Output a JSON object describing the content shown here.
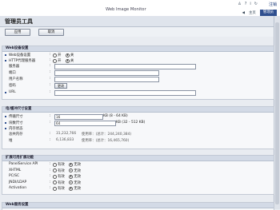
{
  "header": {
    "app_title": "Web Image Monitor",
    "logout": "注销",
    "user_strip": {
      "home": "主页",
      "admin": "管理员"
    }
  },
  "page_title": "管理员工具",
  "buttons": {
    "apply": "应用",
    "cancel": "取消"
  },
  "web_settings": {
    "heading": "Web设备设置",
    "rows": [
      {
        "label": "Web设备设置",
        "options": [
          "开",
          "关"
        ],
        "selected": 1
      },
      {
        "label": "HTTP代理服务器",
        "options": [
          "开",
          "关"
        ],
        "selected": 1
      },
      {
        "label": "服务器"
      },
      {
        "label": "端口"
      },
      {
        "label": "用户名称"
      },
      {
        "label": "密码",
        "button": "更改"
      },
      {
        "label": "URL"
      }
    ]
  },
  "buffer": {
    "heading": "电/缓冲尺寸设置",
    "rows": [
      {
        "label": "传输尺寸",
        "value": "16",
        "unit": "KB (8 - 64 KB)"
      },
      {
        "label": "块数尺寸",
        "value": "64",
        "unit": "KB (32 - 512 KB)"
      },
      {
        "label": "内存状态"
      },
      {
        "label": "总共内存",
        "value": "31,232,766",
        "extra": "使用率：(总计：244,240,384)"
      },
      {
        "label": "堆",
        "value": "6,136,833",
        "extra": "使用率：(总计：16,465,760)"
      }
    ]
  },
  "extensions": {
    "heading": "扩展可用扩展功能",
    "rows": [
      {
        "label": "PanelService API",
        "options": [
          "有效",
          "无效"
        ],
        "selected": 1
      },
      {
        "label": "XHTML",
        "options": [
          "有效",
          "无效"
        ],
        "selected": 1
      },
      {
        "label": "PC/SC",
        "options": [
          "有效",
          "无效"
        ],
        "selected": 1
      },
      {
        "label": "JNDI/LDAP",
        "options": [
          "有效",
          "无效"
        ],
        "selected": 1
      },
      {
        "label": "Activation",
        "options": [
          "有效",
          "无效"
        ],
        "selected": 1
      }
    ]
  },
  "bottom_heading": "Web服务设置"
}
